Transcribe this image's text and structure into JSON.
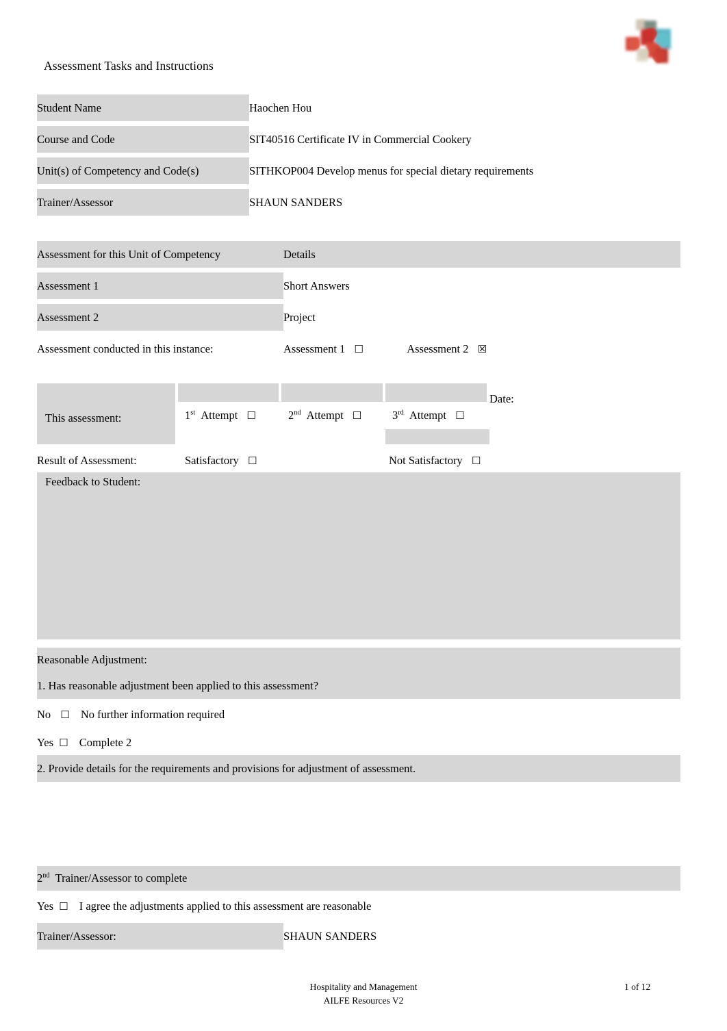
{
  "document": {
    "title": "Assessment Tasks and Instructions"
  },
  "student_details": {
    "rows": [
      {
        "label": "Student Name",
        "value": "Haochen Hou"
      },
      {
        "label": "Course and Code",
        "value": "SIT40516 Certificate IV in Commercial Cookery"
      },
      {
        "label": "Unit(s) of Competency and Code(s)",
        "value": "SITHKOP004 Develop menus for special dietary requirements"
      },
      {
        "label": "Trainer/Assessor",
        "value": "SHAUN SANDERS"
      }
    ]
  },
  "assessment_table": {
    "header_left": "Assessment for this Unit of Competency",
    "header_right": "Details",
    "rows": [
      {
        "label": "Assessment 1",
        "value": "Short Answers"
      },
      {
        "label": "Assessment 2",
        "value": "Project"
      }
    ],
    "conducted_label": "Assessment conducted in this instance:",
    "option_1_label": "Assessment 1",
    "option_1_box": "☐",
    "option_2_label": "Assessment 2",
    "option_2_box": "☒"
  },
  "attempt_table": {
    "this_assessment_label": "This assessment:",
    "attempt_1": {
      "ordinal_num": "1",
      "ordinal_sup": "st",
      "text": "Attempt",
      "box": "☐"
    },
    "attempt_2": {
      "ordinal_num": "2",
      "ordinal_sup": "nd",
      "text": "Attempt",
      "box": "☐"
    },
    "attempt_3": {
      "ordinal_num": "3",
      "ordinal_sup": "rd",
      "text": "Attempt",
      "box": "☐"
    },
    "date_label": "Date:",
    "date_value": "",
    "result_label": "Result of Assessment:",
    "satisfactory_label": "Satisfactory",
    "satisfactory_box": "☐",
    "not_satisfactory_label": "Not Satisfactory",
    "not_satisfactory_box": "☐",
    "feedback_label": "Feedback to Student:",
    "feedback_value": ""
  },
  "reasonable_adjustment": {
    "heading": "Reasonable Adjustment:",
    "question_1": "1.   Has reasonable adjustment been applied to this assessment?",
    "no_label": "No",
    "no_box": "☐",
    "no_text": "No further information required",
    "yes_label": "Yes",
    "yes_box": "☐",
    "yes_text": "Complete 2",
    "question_2": "2.   Provide details for the requirements and provisions for adjustment of assessment.",
    "details_value": "",
    "second_trainer_num": "2",
    "second_trainer_sup": "nd",
    "second_trainer_text": "Trainer/Assessor to complete",
    "agree_label": "Yes",
    "agree_box": "☐",
    "agree_text": "I agree the adjustments applied to this assessment are reasonable",
    "trainer_label": "Trainer/Assessor:",
    "trainer_value": "SHAUN SANDERS"
  },
  "footer": {
    "line1": "Hospitality and Management",
    "line2": "AILFE Resources V2",
    "page": "1 of 12"
  }
}
